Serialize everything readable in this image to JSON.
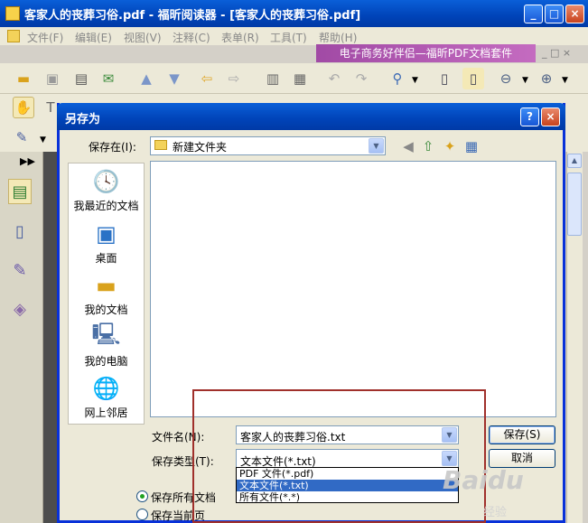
{
  "app": {
    "title": "客家人的丧葬习俗.pdf - 福昕阅读器 - [客家人的丧葬习俗.pdf]",
    "minimize": "_",
    "maximize": "□",
    "close": "×"
  },
  "menu": {
    "items": [
      "文件(F)",
      "编辑(E)",
      "视图(V)",
      "注释(C)",
      "表单(R)",
      "工具(T)",
      "帮助(H)"
    ],
    "banner": "电子商务好伴侣—福昕PDF文档套件",
    "banner_controls": "_ □ ×"
  },
  "dialog": {
    "title": "另存为",
    "help": "?",
    "close": "×",
    "save_in_label": "保存在(I):",
    "save_in_value": "新建文件夹",
    "places": [
      "我最近的文档",
      "桌面",
      "我的文档",
      "我的电脑",
      "网上邻居"
    ],
    "filename_label": "文件名(N):",
    "filename_value": "客家人的丧葬习俗.txt",
    "filetype_label": "保存类型(T):",
    "filetype_value": "文本文件(*.txt)",
    "filetype_options": [
      "PDF 文件(*.pdf)",
      "文本文件(*.txt)",
      "所有文件(*.*)"
    ],
    "selected_option": 1,
    "save_button": "保存(S)",
    "cancel_button": "取消",
    "radio_all": "保存所有文档",
    "radio_current": "保存当前页"
  },
  "watermark": {
    "logo": "Baidu",
    "caption": "经验"
  },
  "colors": {
    "title_bar": "#0054e3",
    "banner": "#b05ab0",
    "highlight": "#316ac5",
    "red_frame": "#a0302b"
  }
}
